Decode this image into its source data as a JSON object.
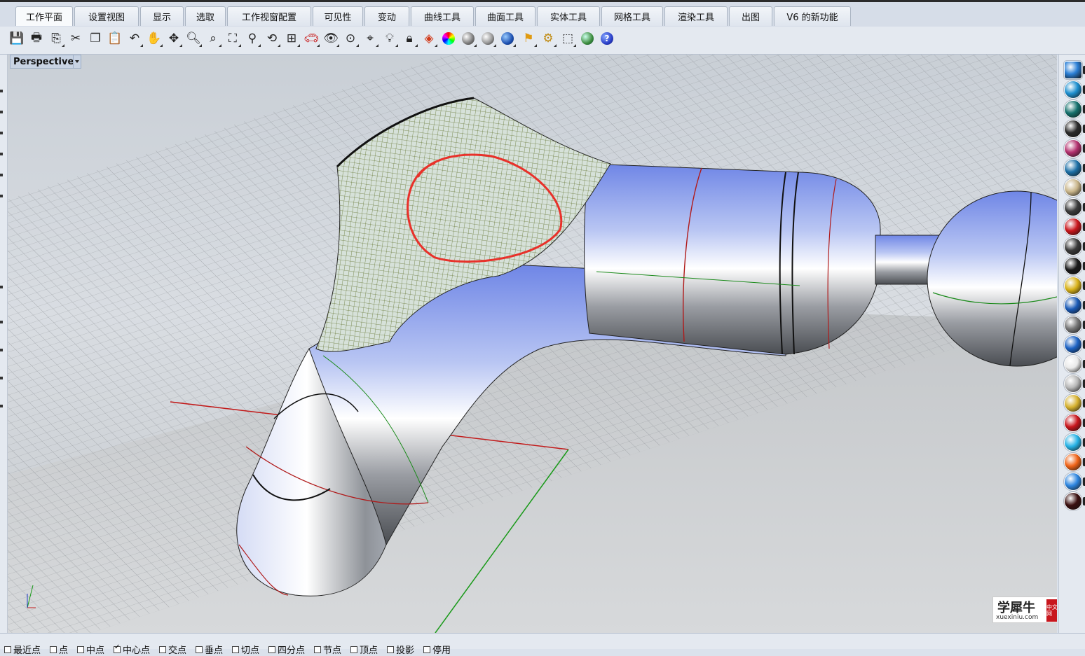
{
  "tabs": [
    {
      "label": "工作平面"
    },
    {
      "label": "设置视图"
    },
    {
      "label": "显示"
    },
    {
      "label": "选取"
    },
    {
      "label": "工作视窗配置"
    },
    {
      "label": "可见性"
    },
    {
      "label": "变动"
    },
    {
      "label": "曲线工具"
    },
    {
      "label": "曲面工具"
    },
    {
      "label": "实体工具"
    },
    {
      "label": "网格工具"
    },
    {
      "label": "渲染工具"
    },
    {
      "label": "出图"
    },
    {
      "label": "V6 的新功能"
    }
  ],
  "toolbar": {
    "icons": [
      "save-icon",
      "print-icon",
      "export-icon",
      "cut-icon",
      "copy-icon",
      "paste-icon",
      "undo-icon",
      "pan-hand-icon",
      "rotate-view-icon",
      "zoom-icon",
      "zoom-window-icon",
      "zoom-extents-icon",
      "zoom-selected-icon",
      "undo-view-icon",
      "four-viewports-icon",
      "car-icon",
      "eye-icon",
      "object-snap-icon",
      "cplane-icon",
      "light-icon",
      "lock-icon",
      "layer-icon",
      "color-wheel-icon",
      "shaded-sphere-icon",
      "rendered-sphere-icon",
      "material-sphere-icon",
      "render-flag-icon",
      "options-gear-icon",
      "select-options-icon",
      "globe-icon",
      "help-icon"
    ]
  },
  "viewport": {
    "name": "Perspective"
  },
  "materials": {
    "colors": [
      "#2a7fd6",
      "#1c8fcf",
      "#13706c",
      "#2a2a2a",
      "#b3306e",
      "#1c6fa6",
      "#c9b58a",
      "#3c3c3c",
      "#c9161c",
      "#3a3a3a",
      "#1a1a1a",
      "#d9b21a",
      "#1a5ab6",
      "#777777",
      "#1d63c4",
      "#eaeaea",
      "#b8b8b8",
      "#d6b12e",
      "#c9161c",
      "#27b3e6",
      "#f06418",
      "#2e86e0",
      "#3a1010"
    ]
  },
  "watermark": {
    "main": "学犀牛",
    "sub": "xuexiniu.com",
    "badge": "中文网"
  },
  "status": {
    "snaps": [
      {
        "label": "最近点",
        "checked": false
      },
      {
        "label": "点",
        "checked": false
      },
      {
        "label": "中点",
        "checked": false
      },
      {
        "label": "中心点",
        "checked": true
      },
      {
        "label": "交点",
        "checked": false
      },
      {
        "label": "垂点",
        "checked": false
      },
      {
        "label": "切点",
        "checked": false
      },
      {
        "label": "四分点",
        "checked": false
      },
      {
        "label": "节点",
        "checked": false
      },
      {
        "label": "顶点",
        "checked": false
      },
      {
        "label": "投影",
        "checked": false
      },
      {
        "label": "停用",
        "checked": false
      }
    ]
  }
}
